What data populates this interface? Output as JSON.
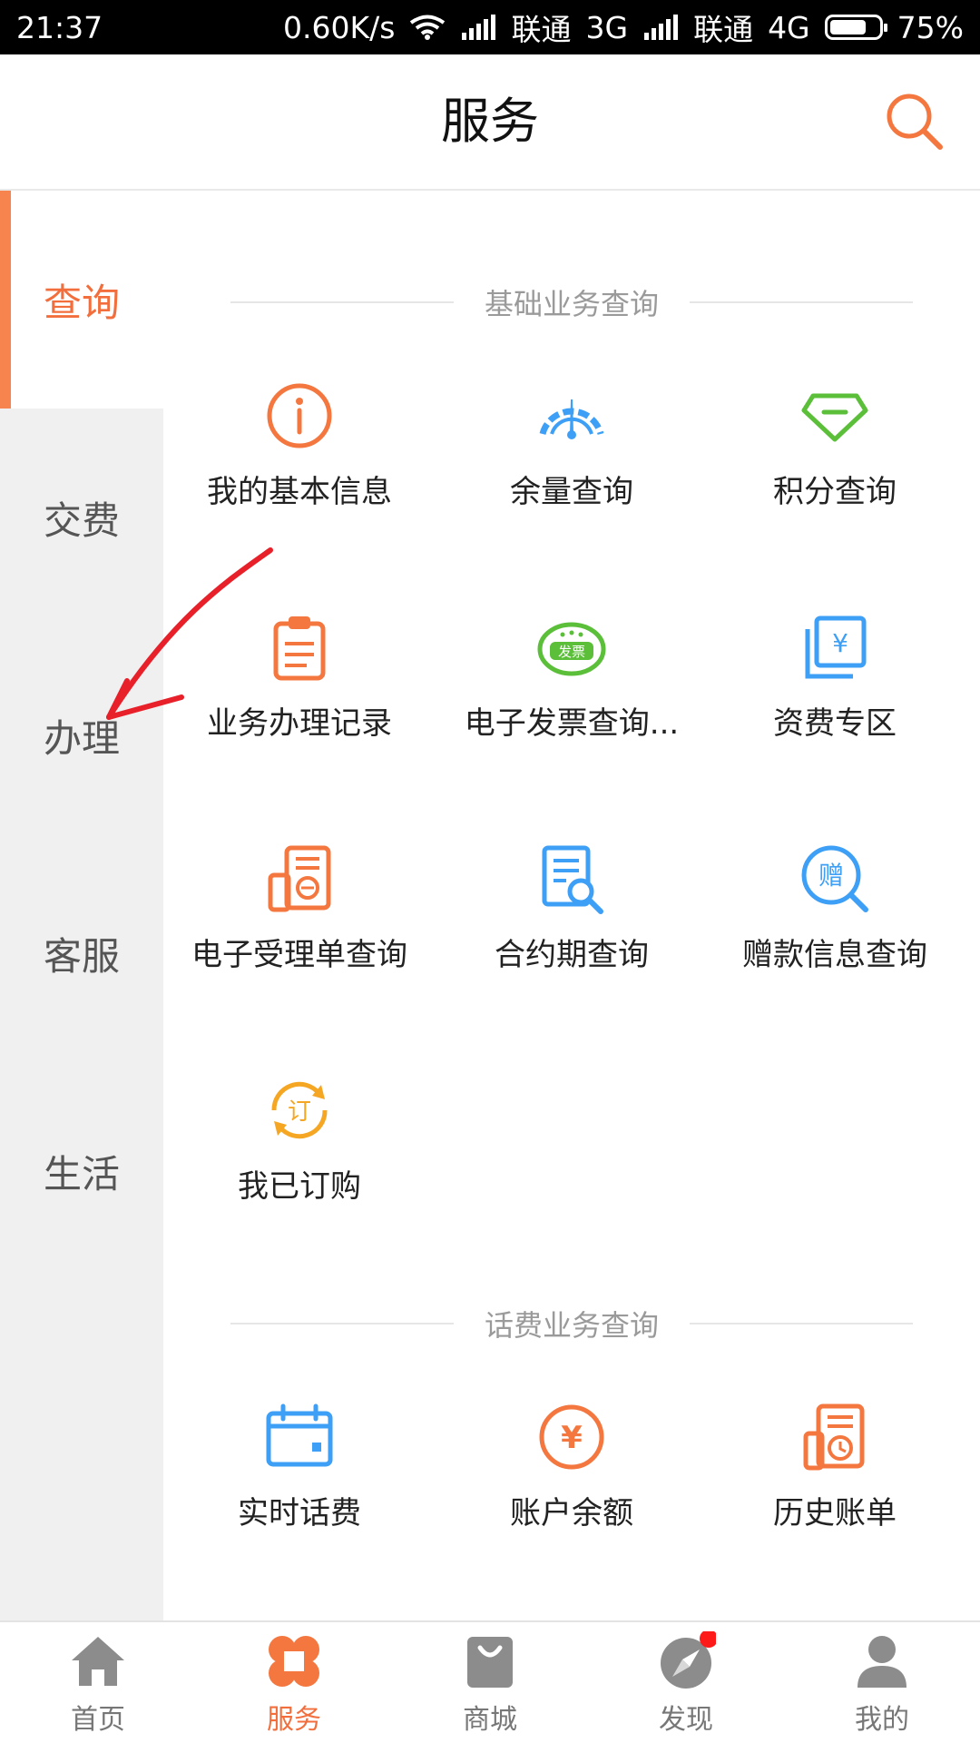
{
  "status_bar": {
    "time": "21:37",
    "speed": "0.60K/s",
    "carrier1": "联通",
    "network1": "3G",
    "carrier2": "联通",
    "network2": "4G",
    "battery": "75%",
    "battery_level": 0.75
  },
  "header": {
    "title": "服务",
    "search_icon": "search-icon"
  },
  "sidebar": {
    "items": [
      {
        "label": "查询",
        "active": true
      },
      {
        "label": "交费",
        "active": false
      },
      {
        "label": "办理",
        "active": false
      },
      {
        "label": "客服",
        "active": false
      },
      {
        "label": "生活",
        "active": false
      }
    ]
  },
  "sections": [
    {
      "title": "基础业务查询",
      "items": [
        {
          "label": "我的基本信息",
          "icon": "info-icon",
          "color": "#f4773f"
        },
        {
          "label": "余量查询",
          "icon": "gauge-icon",
          "color": "#3d9ff5"
        },
        {
          "label": "积分查询",
          "icon": "diamond-icon",
          "color": "#5bbf3a"
        },
        {
          "label": "业务办理记录",
          "icon": "clipboard-icon",
          "color": "#f4773f"
        },
        {
          "label": "电子发票查询...",
          "icon": "invoice-icon",
          "color": "#5bbf3a"
        },
        {
          "label": "资费专区",
          "icon": "tariff-icon",
          "color": "#3d9ff5"
        },
        {
          "label": "电子受理单查询",
          "icon": "e-receipt-icon",
          "color": "#f4773f"
        },
        {
          "label": "合约期查询",
          "icon": "contract-search-icon",
          "color": "#3d9ff5"
        },
        {
          "label": "赠款信息查询",
          "icon": "gift-search-icon",
          "color": "#3d9ff5"
        },
        {
          "label": "我已订购",
          "icon": "subscribed-icon",
          "color": "#f5a623"
        }
      ]
    },
    {
      "title": "话费业务查询",
      "items": [
        {
          "label": "实时话费",
          "icon": "calendar-icon",
          "color": "#3d9ff5"
        },
        {
          "label": "账户余额",
          "icon": "yen-circle-icon",
          "color": "#f4773f"
        },
        {
          "label": "历史账单",
          "icon": "history-bill-icon",
          "color": "#f4773f"
        }
      ]
    }
  ],
  "bottom_nav": [
    {
      "label": "首页",
      "icon": "home-icon",
      "active": false
    },
    {
      "label": "服务",
      "icon": "service-icon",
      "active": true
    },
    {
      "label": "商城",
      "icon": "shopping-bag-icon",
      "active": false
    },
    {
      "label": "发现",
      "icon": "compass-icon",
      "active": false,
      "badge": true
    },
    {
      "label": "我的",
      "icon": "profile-icon",
      "active": false
    }
  ],
  "colors": {
    "accent": "#f26f3d",
    "sidebar_bg": "#f0f0f0",
    "annotation": "#e8202a"
  },
  "invoice_badge_text": "发票",
  "tariff_symbol": "¥",
  "account_symbol": "¥",
  "gift_char": "赠",
  "order_char": "订"
}
